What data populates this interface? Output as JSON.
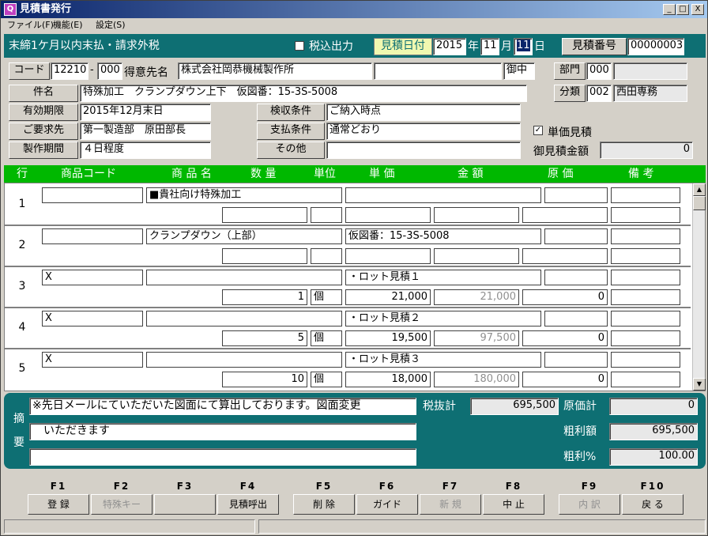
{
  "window": {
    "icon": "Q",
    "title": "見積書発行",
    "btn_min": "_",
    "btn_max": "□",
    "btn_close": "X"
  },
  "menu": [
    "ファイル(F)",
    "機能(E)",
    "設定(S)"
  ],
  "header": {
    "terms": "末締1ケ月以内末払・請求外税",
    "tax_label": "税込出力",
    "date_label": "見積日付",
    "year": "2015",
    "year_unit": "年",
    "month": "11",
    "month_unit": "月",
    "day": "11",
    "day_unit": "日",
    "quote_no_label": "見積番号",
    "quote_no": "00000003"
  },
  "form": {
    "code_label": "コード",
    "code": "12210",
    "dash": "-",
    "code_sub": "000",
    "customer_label": "得意先名",
    "customer": "株式会社岡恭機械製作所",
    "customer_extra": "",
    "honorific": "御中",
    "dept_label": "部門",
    "dept_code": "000",
    "dept_name": "",
    "subject_label": "件名",
    "subject": "特殊加工　クランプダウン上下　仮図番：15-3S-5008",
    "category_label": "分類",
    "category_code": "002",
    "category_name": "西田専務",
    "validity_label": "有効期限",
    "validity": "2015年12月末日",
    "inspection_label": "検収条件",
    "inspection": "ご納入時点",
    "requester_label": "ご要求先",
    "requester": "第一製造部　原田部長",
    "payment_label": "支払条件",
    "payment": "通常どおり",
    "unit_price_check_label": "単価見積",
    "unit_price_checked": "✓",
    "period_label": "製作期間",
    "period": "４日程度",
    "other_label": "その他",
    "other": "",
    "total_label": "御見積金額",
    "total": "0"
  },
  "grid": {
    "headers": [
      "行",
      "商品コード",
      "商 品 名",
      "数 量",
      "単位",
      "単 価",
      "金 額",
      "原 価",
      "備 考"
    ],
    "rows": [
      {
        "no": "1",
        "code": "",
        "name": "■貴社向け特殊加工",
        "name2": "",
        "qty": "",
        "unit": "",
        "spec": "",
        "price": "",
        "amount": "",
        "cost": "",
        "cost2": "",
        "note": "",
        "note2": ""
      },
      {
        "no": "2",
        "code": "",
        "name": "クランプダウン（上部）",
        "name2": "",
        "qty": "",
        "unit": "",
        "spec": "仮図番：15-3S-5008",
        "price": "",
        "amount": "",
        "cost": "",
        "cost2": "",
        "note": "",
        "note2": ""
      },
      {
        "no": "3",
        "code": "X",
        "name": "",
        "name2": "",
        "qty": "1",
        "unit": "個",
        "spec": "・ロット見積１",
        "price": "21,000",
        "amount": "21,000",
        "cost": "",
        "cost2": "0",
        "note": "",
        "note2": ""
      },
      {
        "no": "4",
        "code": "X",
        "name": "",
        "name2": "",
        "qty": "5",
        "unit": "個",
        "spec": "・ロット見積２",
        "price": "19,500",
        "amount": "97,500",
        "cost": "",
        "cost2": "0",
        "note": "",
        "note2": ""
      },
      {
        "no": "5",
        "code": "X",
        "name": "",
        "name2": "",
        "qty": "10",
        "unit": "個",
        "spec": "・ロット見積３",
        "price": "18,000",
        "amount": "180,000",
        "cost": "",
        "cost2": "0",
        "note": "",
        "note2": ""
      }
    ]
  },
  "summary": {
    "label": [
      "摘",
      "要"
    ],
    "memo1": "※先日メールにていただいた図面にて算出しております。図面変更",
    "memo2": "　いただきます",
    "memo3": "",
    "pretax_label": "税抜計",
    "pretax": "695,500",
    "cost_label": "原価計",
    "cost": "0",
    "gross_label": "粗利額",
    "gross": "695,500",
    "gross_pct_label": "粗利%",
    "gross_pct": "100.00"
  },
  "fkeys": [
    {
      "key": "F1",
      "label": "登 録",
      "enabled": true
    },
    {
      "key": "F2",
      "label": "特殊キー",
      "enabled": false
    },
    {
      "key": "F3",
      "label": "",
      "enabled": true
    },
    {
      "key": "F4",
      "label": "見積呼出",
      "enabled": true
    },
    {
      "key": "F5",
      "label": "削 除",
      "enabled": true
    },
    {
      "key": "F6",
      "label": "ガイド",
      "enabled": true
    },
    {
      "key": "F7",
      "label": "新 規",
      "enabled": false
    },
    {
      "key": "F8",
      "label": "中 止",
      "enabled": true
    },
    {
      "key": "F9",
      "label": "内 訳",
      "enabled": false
    },
    {
      "key": "F10",
      "label": "戻 る",
      "enabled": true
    }
  ],
  "colors": {
    "teal": "#0e6f73",
    "green": "#00b800",
    "title_start": "#0a246a",
    "title_end": "#a6caf0"
  }
}
